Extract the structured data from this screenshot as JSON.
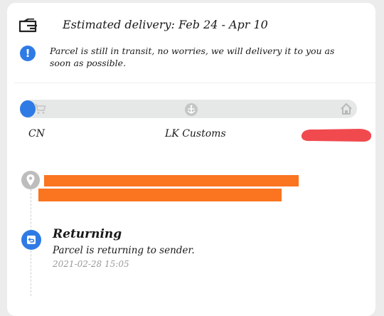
{
  "header": {
    "estimated_delivery": "Estimated delivery: Feb 24 - Apr 10",
    "delivery_icon": "delivery-truck-icon"
  },
  "notice": {
    "icon": "info-icon",
    "icon_glyph": "!",
    "text": "Parcel is still in transit, no worries, we will delivery it to you as soon as possible."
  },
  "progress": {
    "stages": [
      {
        "label": "CN",
        "icon": "cart-icon"
      },
      {
        "label": "LK Customs",
        "icon": "customs-anchor-icon"
      },
      {
        "label": "",
        "icon": "home-icon",
        "redacted": true
      }
    ],
    "current_stage_index": 0
  },
  "timeline": [
    {
      "icon": "location-pin-icon",
      "redacted": true
    },
    {
      "icon": "return-icon",
      "title": "Returning",
      "description": "Parcel is returning to sender.",
      "timestamp": "2021-02-28 15:05"
    }
  ],
  "colors": {
    "accent": "#2f7be5",
    "redaction_orange": "#fb7420",
    "redaction_red": "#f04a4f",
    "track": "#e6e8e8",
    "muted_text": "#9a9a9a"
  }
}
